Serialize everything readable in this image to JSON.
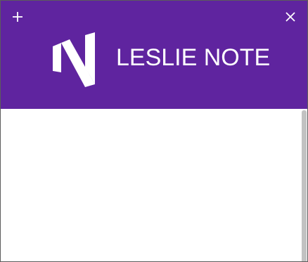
{
  "app": {
    "title": "LESLIE NOTE"
  },
  "header": {
    "new_button_icon": "plus-icon",
    "close_button_icon": "close-icon",
    "logo_icon": "n-logo-icon"
  },
  "content": {
    "notes": []
  },
  "colors": {
    "header_background": "#5f249f",
    "header_foreground": "#ffffff",
    "content_background": "#ffffff",
    "scrollbar_thumb": "#c2c2c2"
  }
}
